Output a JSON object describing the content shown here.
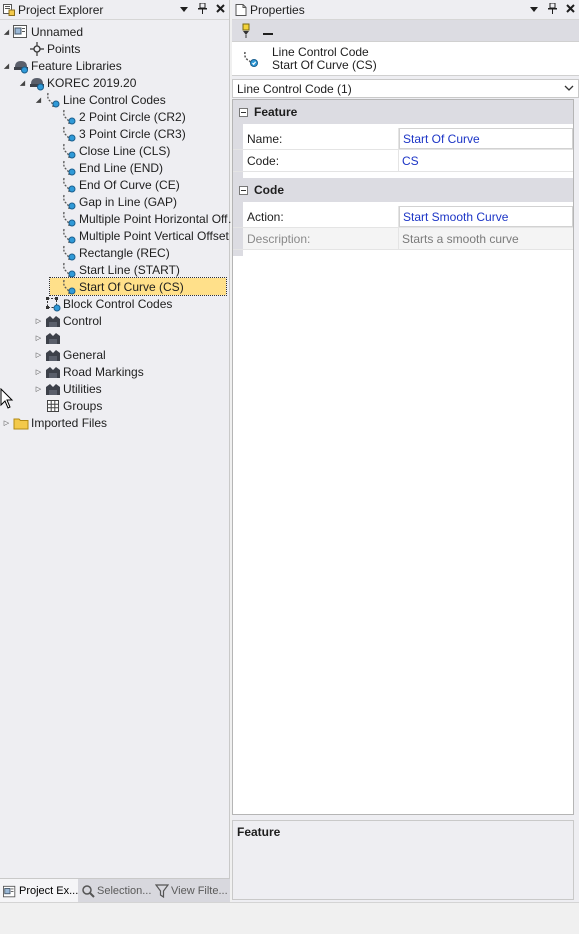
{
  "project_explorer": {
    "title": "Project Explorer",
    "btn_dropdown": "▾",
    "btn_pin": "📌",
    "btn_close": "✕",
    "tree": [
      {
        "key": "unnamed",
        "label": "Unnamed",
        "expander": "◢",
        "icon": "project-icon"
      },
      {
        "key": "points",
        "label": "Points",
        "expander": "",
        "icon": "point-icon"
      },
      {
        "key": "feature-libraries",
        "label": "Feature Libraries",
        "expander": "◢",
        "icon": "library-icon"
      },
      {
        "key": "korec",
        "label": "KOREC 2019.20",
        "expander": "◢",
        "icon": "library-icon"
      },
      {
        "key": "line-control-codes",
        "label": "Line Control Codes",
        "expander": "◢",
        "icon": "line-code-icon"
      },
      {
        "key": "cr2",
        "label": "2 Point Circle (CR2)",
        "expander": "",
        "icon": "line-code-icon"
      },
      {
        "key": "cr3",
        "label": "3 Point Circle (CR3)",
        "expander": "",
        "icon": "line-code-icon"
      },
      {
        "key": "cls",
        "label": "Close Line (CLS)",
        "expander": "",
        "icon": "line-code-icon"
      },
      {
        "key": "end",
        "label": "End Line (END)",
        "expander": "",
        "icon": "line-code-icon"
      },
      {
        "key": "ce",
        "label": "End Of Curve (CE)",
        "expander": "",
        "icon": "line-code-icon"
      },
      {
        "key": "gap",
        "label": "Gap in Line (GAP)",
        "expander": "",
        "icon": "line-code-icon"
      },
      {
        "key": "mph",
        "label": "Multiple Point Horizontal Offset...",
        "expander": "",
        "icon": "line-code-icon"
      },
      {
        "key": "mpv",
        "label": "Multiple Point Vertical Offset (V)",
        "expander": "",
        "icon": "line-code-icon"
      },
      {
        "key": "rec",
        "label": "Rectangle (REC)",
        "expander": "",
        "icon": "line-code-icon"
      },
      {
        "key": "start",
        "label": "Start Line (START)",
        "expander": "",
        "icon": "line-code-icon"
      },
      {
        "key": "cs",
        "label": "Start Of Curve (CS)",
        "expander": "",
        "icon": "line-code-icon"
      },
      {
        "key": "block-control-codes",
        "label": "Block Control Codes",
        "expander": "",
        "icon": "block-code-icon"
      },
      {
        "key": "control",
        "label": "Control",
        "expander": "▷",
        "icon": "feature-group-icon"
      },
      {
        "key": "blank",
        "label": "",
        "expander": "▷",
        "icon": "feature-group-icon"
      },
      {
        "key": "general",
        "label": "General",
        "expander": "▷",
        "icon": "feature-group-icon"
      },
      {
        "key": "road-markings",
        "label": "Road Markings",
        "expander": "▷",
        "icon": "feature-group-icon"
      },
      {
        "key": "utilities",
        "label": "Utilities",
        "expander": "▷",
        "icon": "feature-group-icon"
      },
      {
        "key": "groups",
        "label": "Groups",
        "expander": "",
        "icon": "grid-icon"
      },
      {
        "key": "imported-files",
        "label": "Imported Files",
        "expander": "▷",
        "icon": "folder-icon"
      }
    ],
    "selected_key": "cs",
    "bottom_tabs": [
      {
        "label": "Project Ex...",
        "icon": "project-icon",
        "active": true
      },
      {
        "label": "Selection...",
        "icon": "selection-icon",
        "active": false
      },
      {
        "label": "View Filte...",
        "icon": "filter-icon",
        "active": false
      }
    ]
  },
  "properties": {
    "title": "Properties",
    "btn_dropdown": "▾",
    "btn_pin": "📌",
    "btn_close": "✕",
    "object_type": "Line Control Code",
    "object_name": "Start Of Curve (CS)",
    "selector_value": "Line Control Code (1)",
    "categories": [
      {
        "name": "Feature",
        "rows": [
          {
            "name": "Name:",
            "value": "Start Of Curve",
            "readonly": false
          },
          {
            "name": "Code:",
            "value": "CS",
            "readonly": false
          }
        ]
      },
      {
        "name": "Code",
        "rows": [
          {
            "name": "Action:",
            "value": "Start Smooth Curve",
            "readonly": false
          },
          {
            "name": "Description:",
            "value": "Starts a smooth curve",
            "readonly": true
          }
        ]
      }
    ],
    "description_title": "Feature"
  },
  "colors": {
    "selected_bg": "#ffe08a",
    "value_text": "#1c35c6",
    "pane_bg": "#eeeef2"
  }
}
